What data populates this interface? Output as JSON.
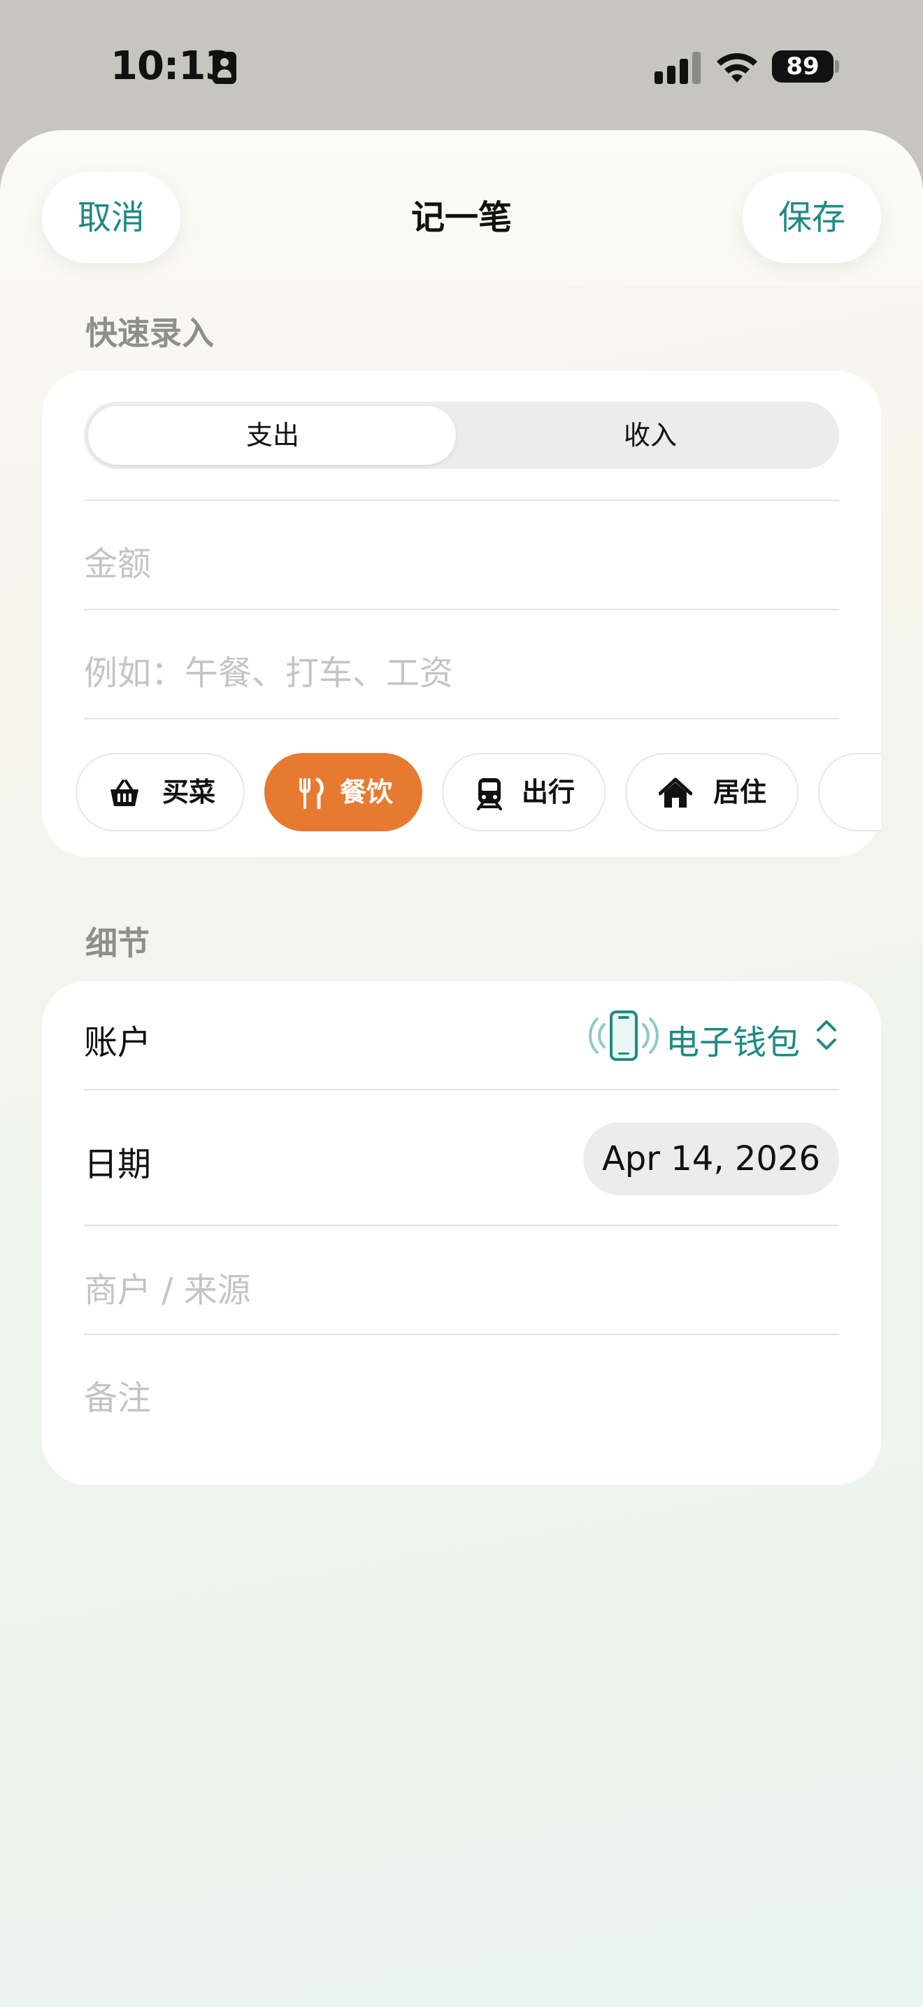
{
  "status_bar": {
    "time": "10:13",
    "battery": "89"
  },
  "nav": {
    "cancel_label": "取消",
    "title": "记一笔",
    "save_label": "保存"
  },
  "quick_entry": {
    "section_label": "快速录入",
    "segments": [
      {
        "label": "支出",
        "selected": true
      },
      {
        "label": "收入",
        "selected": false
      }
    ],
    "amount_placeholder": "金额",
    "description_placeholder": "例如：午餐、打车、工资",
    "categories": [
      {
        "label": "买菜",
        "icon": "basket-icon",
        "selected": false
      },
      {
        "label": "餐饮",
        "icon": "fork-knife-icon",
        "selected": true
      },
      {
        "label": "出行",
        "icon": "train-icon",
        "selected": false
      },
      {
        "label": "居住",
        "icon": "house-icon",
        "selected": false
      }
    ]
  },
  "details": {
    "section_label": "细节",
    "account_label": "账户",
    "account_value": "电子钱包",
    "account_icon": "phone-icon",
    "date_label": "日期",
    "date_value": "Apr 14, 2026",
    "merchant_placeholder": "商户 / 来源",
    "note_placeholder": "备注"
  },
  "colors": {
    "accent": "#1f8a82",
    "category_selected": "#e77a31"
  }
}
